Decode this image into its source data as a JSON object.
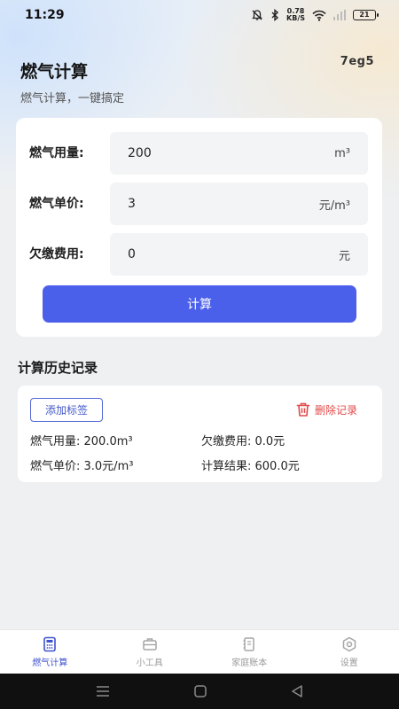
{
  "status_bar": {
    "time": "11:29",
    "speed_value": "0.78",
    "speed_unit": "KB/S",
    "battery": "21"
  },
  "header": {
    "title": "燃气计算",
    "code": "7eg5",
    "subtitle": "燃气计算，一键搞定"
  },
  "form": {
    "usage": {
      "label": "燃气用量:",
      "value": "200",
      "unit": "m³"
    },
    "price": {
      "label": "燃气单价:",
      "value": "3",
      "unit": "元/m³"
    },
    "arrears": {
      "label": "欠缴费用:",
      "value": "0",
      "unit": "元"
    },
    "calculate_label": "计算"
  },
  "history": {
    "title": "计算历史记录",
    "add_tag_label": "添加标签",
    "delete_label": "删除记录",
    "record": {
      "usage": "燃气用量: 200.0m³",
      "arrears": "欠缴费用: 0.0元",
      "price": "燃气单价: 3.0元/m³",
      "result": "计算结果: 600.0元"
    }
  },
  "bottom_nav": {
    "items": [
      {
        "label": "燃气计算",
        "icon": "calculator-icon"
      },
      {
        "label": "小工具",
        "icon": "toolbox-icon"
      },
      {
        "label": "家庭账本",
        "icon": "ledger-icon"
      },
      {
        "label": "设置",
        "icon": "settings-icon"
      }
    ]
  },
  "colors": {
    "accent": "#4a5fea",
    "delete": "#e34949",
    "active_nav": "#3e52cf"
  }
}
